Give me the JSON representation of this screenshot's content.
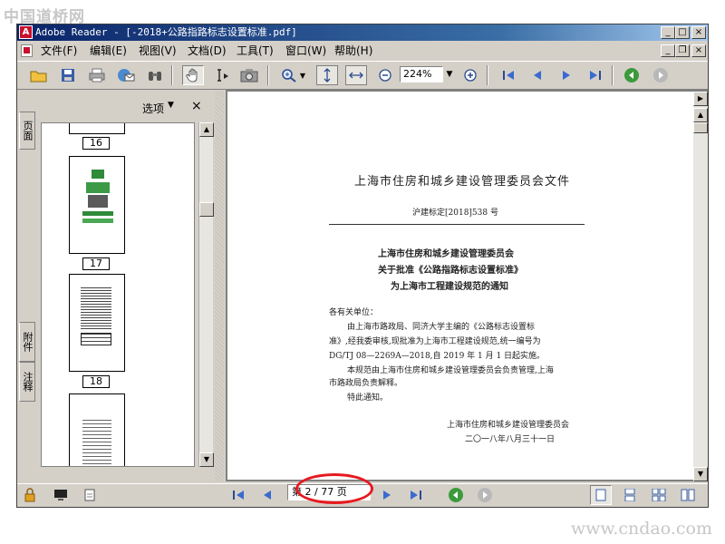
{
  "watermarks": {
    "top": "中国道桥网",
    "bottom": "www.cndao.com"
  },
  "window": {
    "title": "Adobe Reader - [-2018+公路指路标志设置标准.pdf]"
  },
  "menu": {
    "items": [
      "文件(F)",
      "编辑(E)",
      "视图(V)",
      "文档(D)",
      "工具(T)",
      "窗口(W)",
      "帮助(H)"
    ]
  },
  "toolbar": {
    "zoom": "224%"
  },
  "panel": {
    "options_label": "选项",
    "close": "×",
    "tabs": [
      "页面",
      "附件",
      "注释"
    ]
  },
  "thumbnails": [
    "16",
    "17",
    "18"
  ],
  "document": {
    "header": "上海市住房和城乡建设管理委员会文件",
    "doc_number": "沪建标定[2018]538 号",
    "notice_title": [
      "上海市住房和城乡建设管理委员会",
      "关于批准《公路指路标志设置标准》",
      "为上海市工程建设规范的通知"
    ],
    "salutation": "各有关单位：",
    "body": [
      "由上海市路政局、同济大学主编的《公路标志设置标",
      "准》,经我委审核,现批准为上海市工程建设规范,统一编号为",
      "DG/TJ 08—2269A—2018,自 2019 年 1 月 1 日起实施。",
      "本规范由上海市住房和城乡建设管理委员会负责管理,上海",
      "市路政局负责解释。",
      "特此通知。"
    ],
    "signature": "上海市住房和城乡建设管理委员会",
    "date": "二〇一八年八月三十一日"
  },
  "status": {
    "page_indicator": "第 2 / 77 页"
  }
}
